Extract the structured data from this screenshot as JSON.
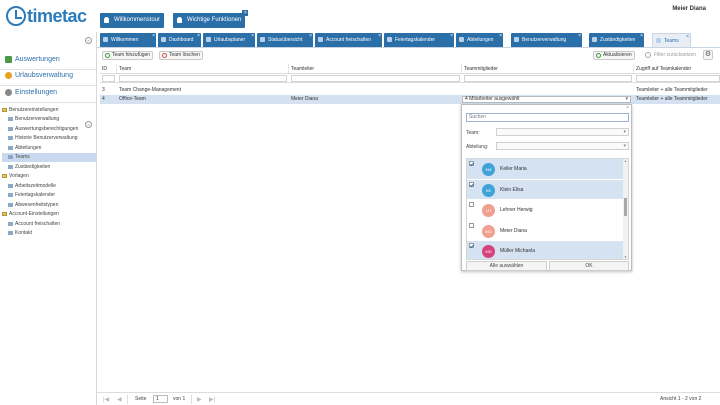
{
  "header": {
    "logo_text": "timetac",
    "user_name": "Meier Diana",
    "buttons": [
      {
        "label": "Willkommenstour"
      },
      {
        "label": "Wichtige Funktionen"
      }
    ]
  },
  "sidebar": {
    "nav": [
      {
        "label": "Auswertungen",
        "icon": "chart-icon",
        "color": "#4a9a4a"
      },
      {
        "label": "Urlaubsverwaltung",
        "icon": "sun-icon",
        "color": "#e8a21c"
      },
      {
        "label": "Einstellungen",
        "icon": "gear-icon",
        "color": "#888888"
      }
    ],
    "tree": [
      {
        "label": "Benutzereinstellungen",
        "type": "folder",
        "level": 0
      },
      {
        "label": "Benutzerverwaltung",
        "type": "leaf",
        "level": 1
      },
      {
        "label": "Auswertungsberechtigungen",
        "type": "leaf",
        "level": 1
      },
      {
        "label": "Historie Benutzerverwaltung",
        "type": "leaf",
        "level": 1
      },
      {
        "label": "Abteilungen",
        "type": "leaf",
        "level": 1
      },
      {
        "label": "Teams",
        "type": "leaf",
        "level": 1,
        "selected": true
      },
      {
        "label": "Zuständigkeiten",
        "type": "leaf",
        "level": 1
      },
      {
        "label": "Vorlagen",
        "type": "folder",
        "level": 0
      },
      {
        "label": "Arbeitszeitmodelle",
        "type": "leaf",
        "level": 1
      },
      {
        "label": "Feiertagskalender",
        "type": "leaf",
        "level": 1
      },
      {
        "label": "Abwesenheitstypen",
        "type": "leaf",
        "level": 1
      },
      {
        "label": "Account-Einstellungen",
        "type": "folder",
        "level": 0
      },
      {
        "label": "Account freischalten",
        "type": "leaf",
        "level": 1
      },
      {
        "label": "Kontakt",
        "type": "leaf",
        "level": 1
      }
    ]
  },
  "tabs": [
    {
      "label": "Willkommen"
    },
    {
      "label": "Dashboard"
    },
    {
      "label": "Urlaubsplaner"
    },
    {
      "label": "Statusübersicht"
    },
    {
      "label": "Account freischalten"
    },
    {
      "label": "Feiertagskalender"
    },
    {
      "label": "Abteilungen"
    },
    {
      "label": "Benutzerverwaltung"
    },
    {
      "label": "Zuständigkeiten"
    },
    {
      "label": "Teams",
      "active": true
    }
  ],
  "toolbar": {
    "add_label": "Team hinzufügen",
    "delete_label": "Team löschen",
    "refresh_label": "Aktualisieren",
    "filter_label": "Filter zurücksetzen"
  },
  "grid": {
    "columns": [
      "ID",
      "Team",
      "Teamleiter",
      "Teammitglieder",
      "Zugriff auf Teamkalender"
    ],
    "rows": [
      {
        "id": "3",
        "team": "Team Change-Management",
        "leader": "",
        "members": "",
        "access": "Teamleiter + alle Teammitglieder"
      },
      {
        "id": "4",
        "team": "Office-Team",
        "leader": "Meier Diana",
        "members": "4 Mitarbeiter ausgewählt",
        "access": "Teamleiter + alle Teammitglieder"
      }
    ]
  },
  "dropdown": {
    "search_placeholder": "Suchen",
    "team_label": "Team:",
    "department_label": "Abteilung:",
    "members": [
      {
        "initials": "KM",
        "name": "Keller Maria",
        "checked": true,
        "color": "#3fa3d8"
      },
      {
        "initials": "KE",
        "name": "Klein Elisa",
        "checked": true,
        "color": "#3fa3d8"
      },
      {
        "initials": "LH",
        "name": "Lehner Herwig",
        "checked": false,
        "color": "#f0a08e"
      },
      {
        "initials": "MD",
        "name": "Meier Diana",
        "checked": false,
        "color": "#f0a08e"
      },
      {
        "initials": "MD",
        "name": "Müller Michaela",
        "checked": true,
        "color": "#d6437a"
      }
    ],
    "select_all_label": "Alle auswählen",
    "ok_label": "OK"
  },
  "pager": {
    "page_label": "Seite",
    "page_value": "1",
    "of_label": "von 1",
    "summary": "Ansicht 1 - 2 von 2"
  }
}
